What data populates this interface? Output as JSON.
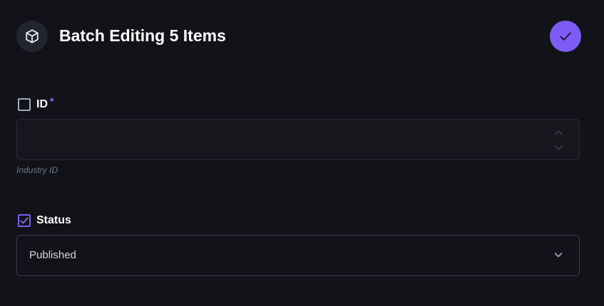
{
  "header": {
    "title": "Batch Editing 5 Items",
    "icon": "box-icon",
    "confirm_icon": "check-icon",
    "accent_color": "#7c5cf5"
  },
  "fields": [
    {
      "label": "ID",
      "required_marker": "*",
      "included": false,
      "value": "",
      "hint": "Industry ID",
      "type": "number"
    },
    {
      "label": "Status",
      "included": true,
      "value": "Published",
      "type": "select"
    }
  ]
}
